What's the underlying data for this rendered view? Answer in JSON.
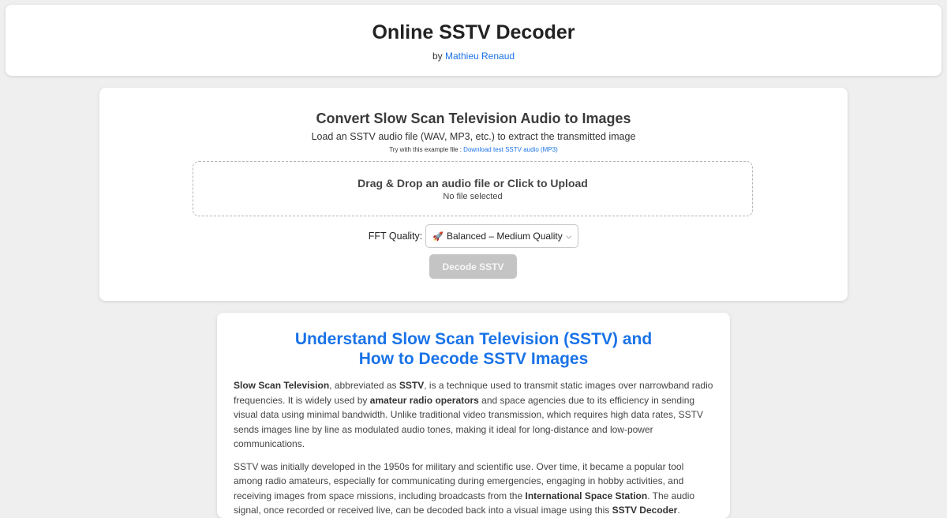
{
  "header": {
    "title": "Online SSTV Decoder",
    "by_prefix": "by",
    "author": "Mathieu Renaud"
  },
  "tool": {
    "heading": "Convert Slow Scan Television Audio to Images",
    "subtitle": "Load an SSTV audio file (WAV, MP3, etc.) to extract the transmitted image",
    "example_prefix": "Try with this example file :",
    "example_link": "Download test SSTV audio (MP3)",
    "dropzone_title": "Drag & Drop an audio file or Click to Upload",
    "dropzone_status": "No file selected",
    "fft_label": "FFT Quality:",
    "fft_icon": "rocket-icon",
    "fft_selected": "Balanced – Medium Quality",
    "decode_label": "Decode SSTV",
    "decode_enabled": false
  },
  "info": {
    "heading_line1": "Understand Slow Scan Television (SSTV) and",
    "heading_line2": "How to Decode SSTV Images",
    "p1": {
      "t1": "Slow Scan Television",
      "t2": ", abbreviated as ",
      "t3": "SSTV",
      "t4": ", is a technique used to transmit static images over narrowband radio frequencies. It is widely used by ",
      "t5": "amateur radio operators",
      "t6": " and space agencies due to its efficiency in sending visual data using minimal bandwidth. Unlike traditional video transmission, which requires high data rates, SSTV sends images line by line as modulated audio tones, making it ideal for long-distance and low-power communications."
    },
    "p2": {
      "t1": "SSTV was initially developed in the 1950s for military and scientific use. Over time, it became a popular tool among radio amateurs, especially for communicating during emergencies, engaging in hobby activities, and receiving images from space missions, including broadcasts from the ",
      "t2": "International Space Station",
      "t3": ". The audio signal, once recorded or received live, can be decoded back into a visual image using this ",
      "t4": "SSTV Decoder",
      "t5": "."
    }
  },
  "colors": {
    "background": "#efefef",
    "link": "#1a73e8",
    "button_disabled": "#c4c4c4"
  }
}
